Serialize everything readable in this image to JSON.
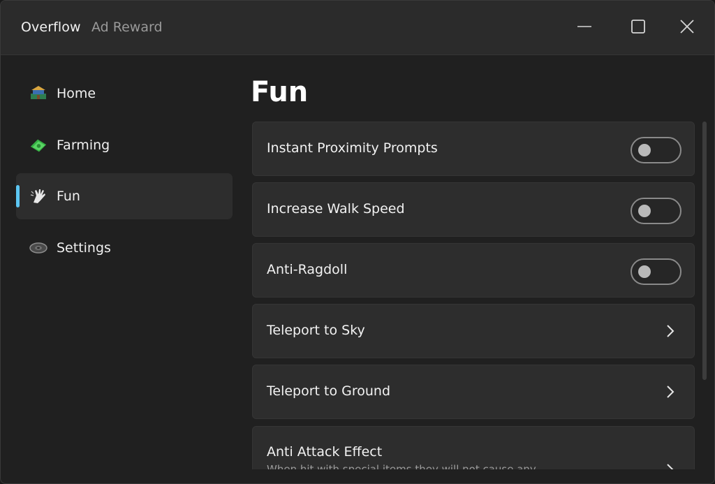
{
  "window": {
    "title": "Overflow",
    "subtitle": "Ad Reward",
    "controls": [
      "minimize",
      "maximize",
      "close"
    ]
  },
  "sidebar": {
    "items": [
      {
        "label": "Home",
        "icon": "house-icon",
        "active": false
      },
      {
        "label": "Farming",
        "icon": "cash-icon",
        "active": false
      },
      {
        "label": "Fun",
        "icon": "hand-icon",
        "active": true
      },
      {
        "label": "Settings",
        "icon": "gear-icon",
        "active": false
      }
    ]
  },
  "main": {
    "title": "Fun",
    "options": [
      {
        "label": "Instant Proximity Prompts",
        "type": "toggle",
        "enabled": false
      },
      {
        "label": "Increase Walk Speed",
        "type": "toggle",
        "enabled": false
      },
      {
        "label": "Anti-Ragdoll",
        "type": "toggle",
        "enabled": false
      },
      {
        "label": "Teleport to Sky",
        "type": "action"
      },
      {
        "label": "Teleport to Ground",
        "type": "action"
      },
      {
        "label": "Anti Attack Effect",
        "description": "When hit with special items they will not cause any",
        "type": "action"
      }
    ]
  },
  "colors": {
    "accent": "#5cc6f2",
    "background": "#202020",
    "card": "#2d2d2d"
  }
}
